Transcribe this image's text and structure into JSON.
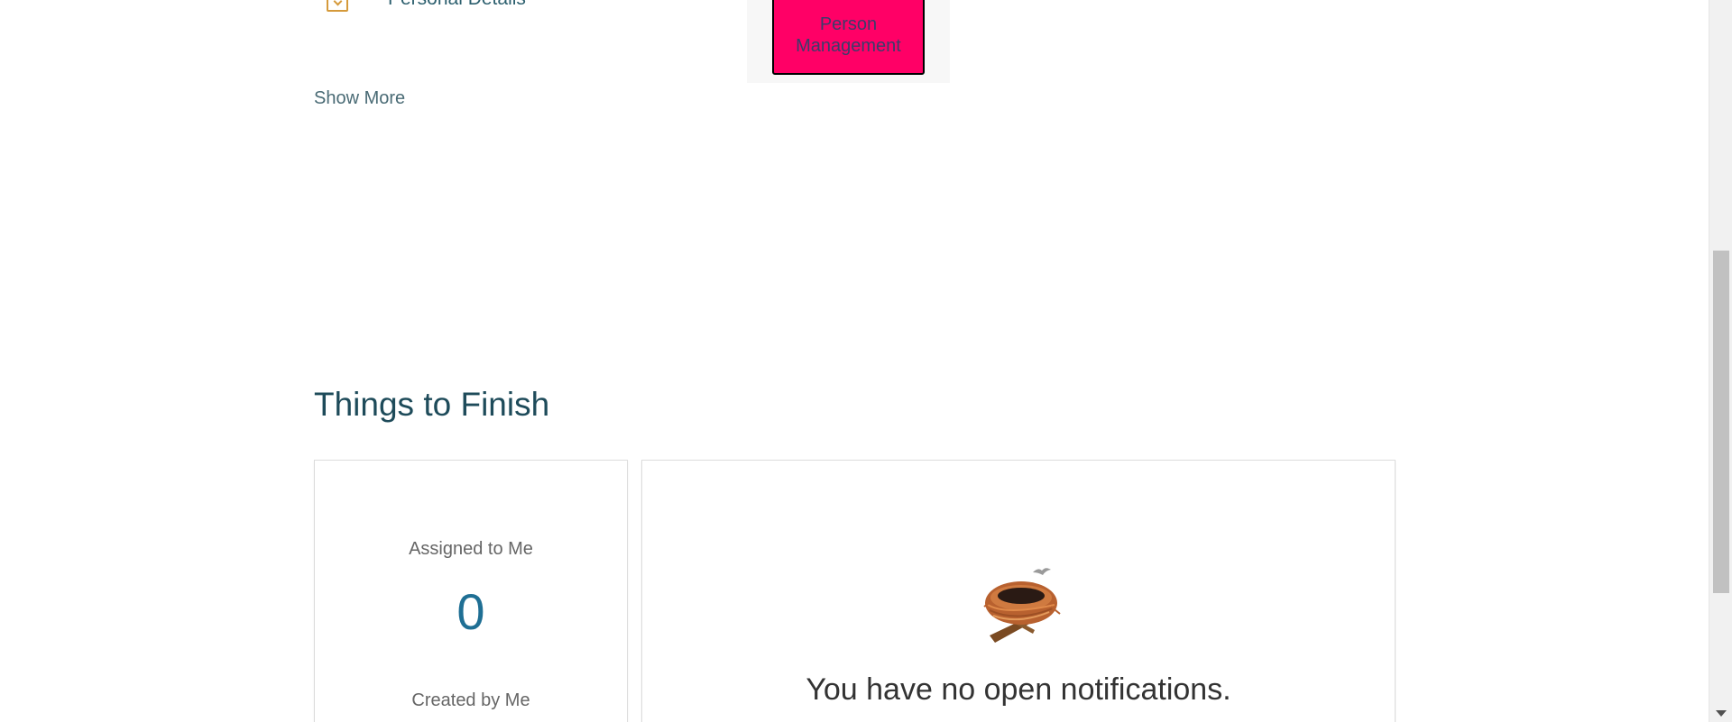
{
  "quick_actions": {
    "items": [
      {
        "label": "Personal Details",
        "icon": "document-check-icon"
      }
    ],
    "show_more_label": "Show More"
  },
  "highlight_button": {
    "label": "Person Management",
    "background": "#ff0066"
  },
  "things_to_finish": {
    "title": "Things to Finish",
    "assigned_label": "Assigned to Me",
    "assigned_count": "0",
    "created_label": "Created by Me",
    "notifications_empty_message": "You have no open notifications.",
    "empty_icon": "bird-nest-icon"
  },
  "colors": {
    "accent": "#1f6f94",
    "heading": "#1e4b5a",
    "icon": "#d59a3b"
  }
}
